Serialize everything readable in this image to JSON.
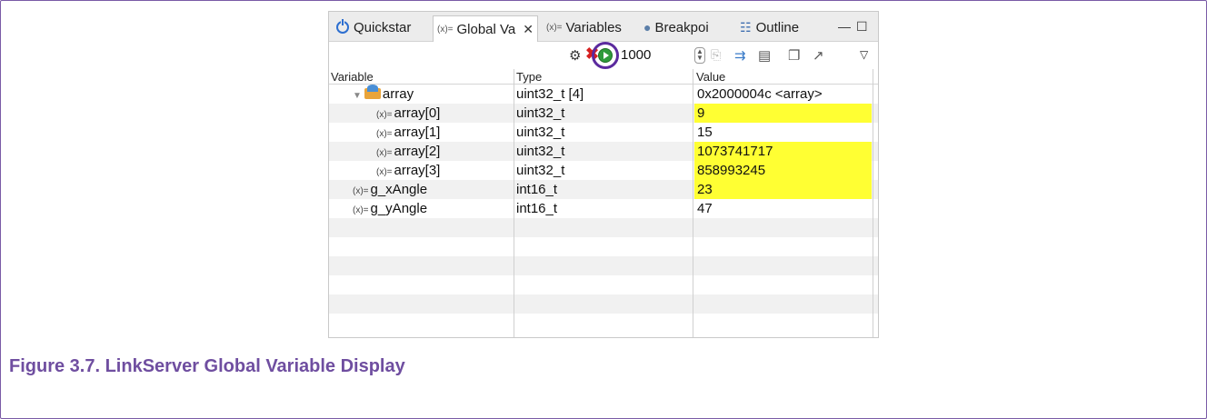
{
  "tabs": [
    {
      "label": "Quickstar",
      "icon": "power-icon"
    },
    {
      "label": "Global Va",
      "icon": "variable-icon",
      "prefix": "(x)=",
      "active": true
    },
    {
      "label": "Variables",
      "icon": "variable-icon",
      "prefix": "(x)="
    },
    {
      "label": "Breakpoi",
      "icon": "breakpoint-icon"
    },
    {
      "label": "Outline",
      "icon": "outline-icon"
    }
  ],
  "toolbar": {
    "interval_value": "1000",
    "icons": [
      "add-variable-icon",
      "remove-icon",
      "start-refresh-icon",
      "spinner-icon",
      "collapse-icon",
      "expand-icon",
      "layout-icon",
      "new-icon",
      "export-icon",
      "view-menu-icon"
    ]
  },
  "table": {
    "headers": {
      "variable": "Variable",
      "type": "Type",
      "value": "Value"
    },
    "rows": [
      {
        "variable": "array",
        "type": "uint32_t [4]",
        "value": "0x2000004c <array>",
        "changed": false,
        "kind": "array-parent"
      },
      {
        "variable": "array[0]",
        "type": "uint32_t",
        "value": "9",
        "changed": true,
        "kind": "child"
      },
      {
        "variable": "array[1]",
        "type": "uint32_t",
        "value": "15",
        "changed": false,
        "kind": "child"
      },
      {
        "variable": "array[2]",
        "type": "uint32_t",
        "value": "1073741717",
        "changed": true,
        "kind": "child"
      },
      {
        "variable": "array[3]",
        "type": "uint32_t",
        "value": "858993245",
        "changed": true,
        "kind": "child"
      },
      {
        "variable": "g_xAngle",
        "type": "int16_t",
        "value": "23",
        "changed": true,
        "kind": "top"
      },
      {
        "variable": "g_yAngle",
        "type": "int16_t",
        "value": "47",
        "changed": false,
        "kind": "top"
      }
    ]
  },
  "caption": "Figure 3.7. LinkServer Global Variable Display",
  "colors": {
    "highlight": "#ffff33",
    "caption": "#6f4ea0",
    "ring": "#5b2a9e",
    "play": "#2e9a3a"
  }
}
